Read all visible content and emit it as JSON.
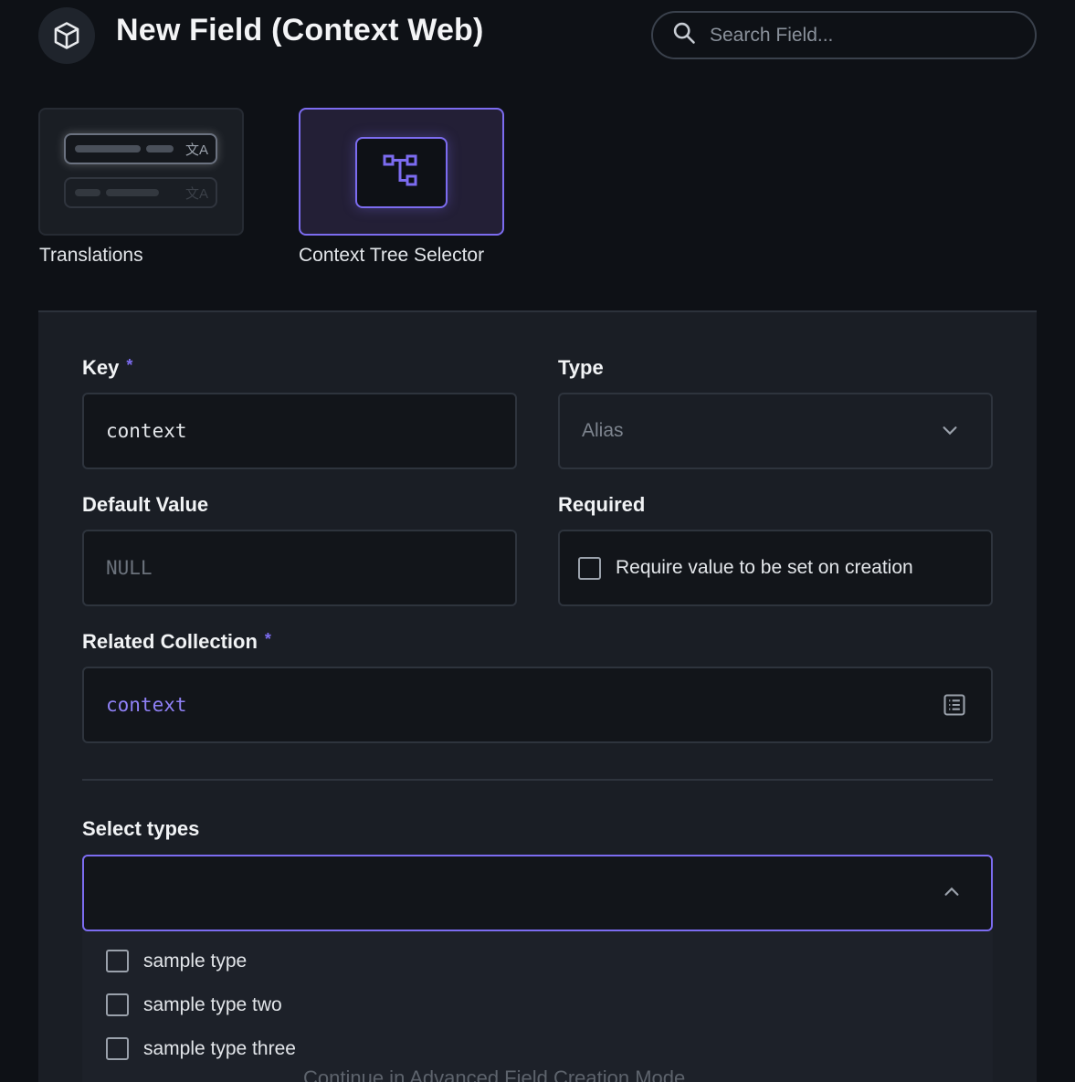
{
  "header": {
    "title": "New Field (Context Web)",
    "search_placeholder": "Search Field..."
  },
  "interfaces": [
    {
      "label": "Translations",
      "selected": false
    },
    {
      "label": "Context Tree Selector",
      "selected": true
    }
  ],
  "form": {
    "key": {
      "label": "Key",
      "required_mark": "*",
      "value": "context"
    },
    "type": {
      "label": "Type",
      "value": "Alias"
    },
    "default_value": {
      "label": "Default Value",
      "placeholder": "NULL"
    },
    "required": {
      "label": "Required",
      "checkbox_label": "Require value to be set on creation",
      "checked": false
    },
    "related_collection": {
      "label": "Related Collection",
      "required_mark": "*",
      "value": "context"
    },
    "select_types": {
      "label": "Select types",
      "options": [
        {
          "label": "sample type",
          "checked": false
        },
        {
          "label": "sample type two",
          "checked": false
        },
        {
          "label": "sample type three",
          "checked": false
        }
      ]
    }
  },
  "footer": {
    "advanced_link": "Continue in Advanced Field Creation Mode"
  },
  "colors": {
    "accent": "#7c6cf0",
    "background": "#0e1116",
    "panel": "#1a1e25"
  }
}
